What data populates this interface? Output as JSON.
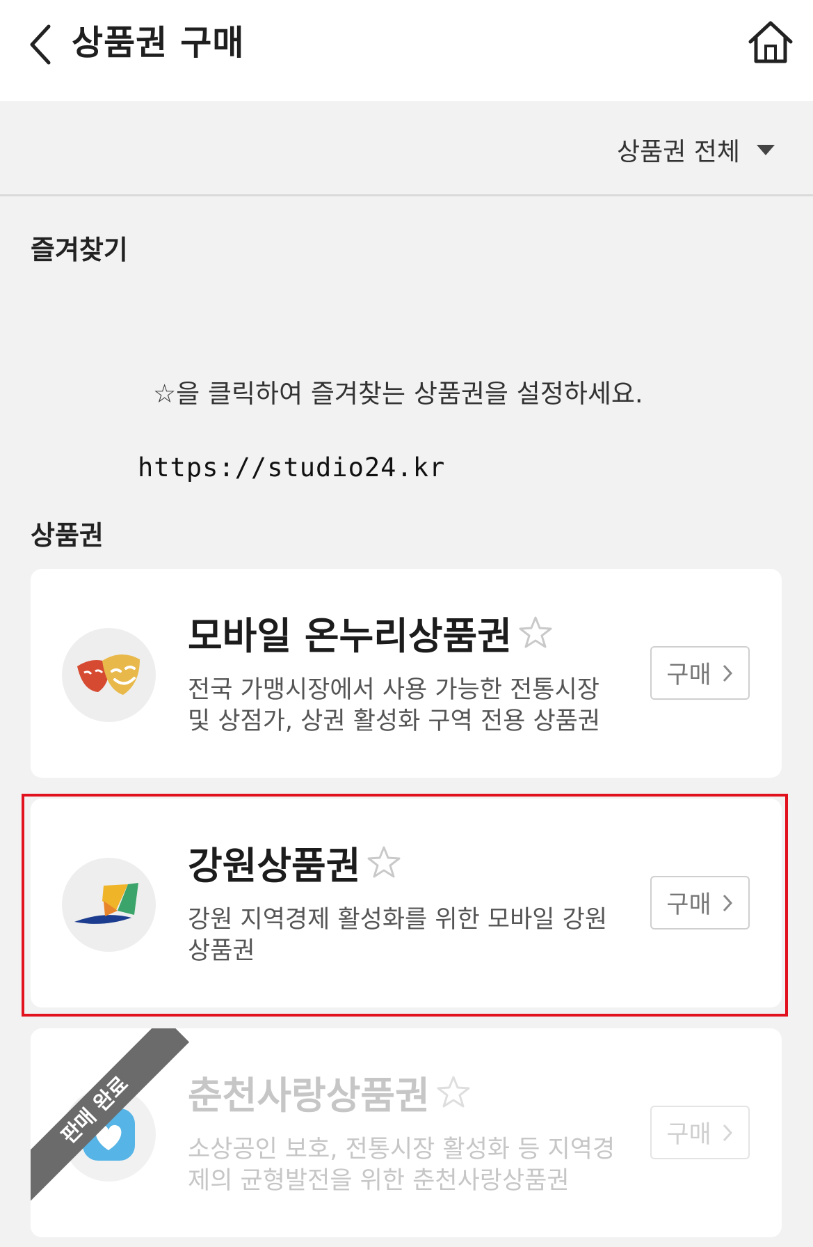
{
  "header": {
    "title": "상품권 구매",
    "back_icon": "chevron-left-icon",
    "home_icon": "home-icon"
  },
  "filter": {
    "selected": "상품권 전체",
    "icon": "caret-down-icon"
  },
  "favorites": {
    "title": "즐겨찾기",
    "empty_message": "☆을 클릭하여 즐겨찾는 상품권을 설정하세요."
  },
  "watermark_url": "https://studio24.kr",
  "vouchers": {
    "title": "상품권",
    "items": [
      {
        "name": "모바일 온누리상품권",
        "description": "전국 가맹시장에서 사용 가능한 전통시장 및 상점가, 상권 활성화 구역 전용 상품권",
        "buy_label": "구매",
        "status": "available"
      },
      {
        "name": "강원상품권",
        "description": "강원 지역경제 활성화를 위한 모바일 강원상품권",
        "buy_label": "구매",
        "status": "available",
        "highlighted": true
      },
      {
        "name": "춘천사랑상품권",
        "description": "소상공인 보호, 전통시장 활성화 등 지역경제의 균형발전을 위한 춘천사랑상품권",
        "buy_label": "구매",
        "status": "sold_out",
        "ribbon": "판매 완료"
      }
    ]
  },
  "colors": {
    "highlight": "#e1111d",
    "background": "#f2f2f2",
    "ribbon": "#6b6b6b"
  }
}
